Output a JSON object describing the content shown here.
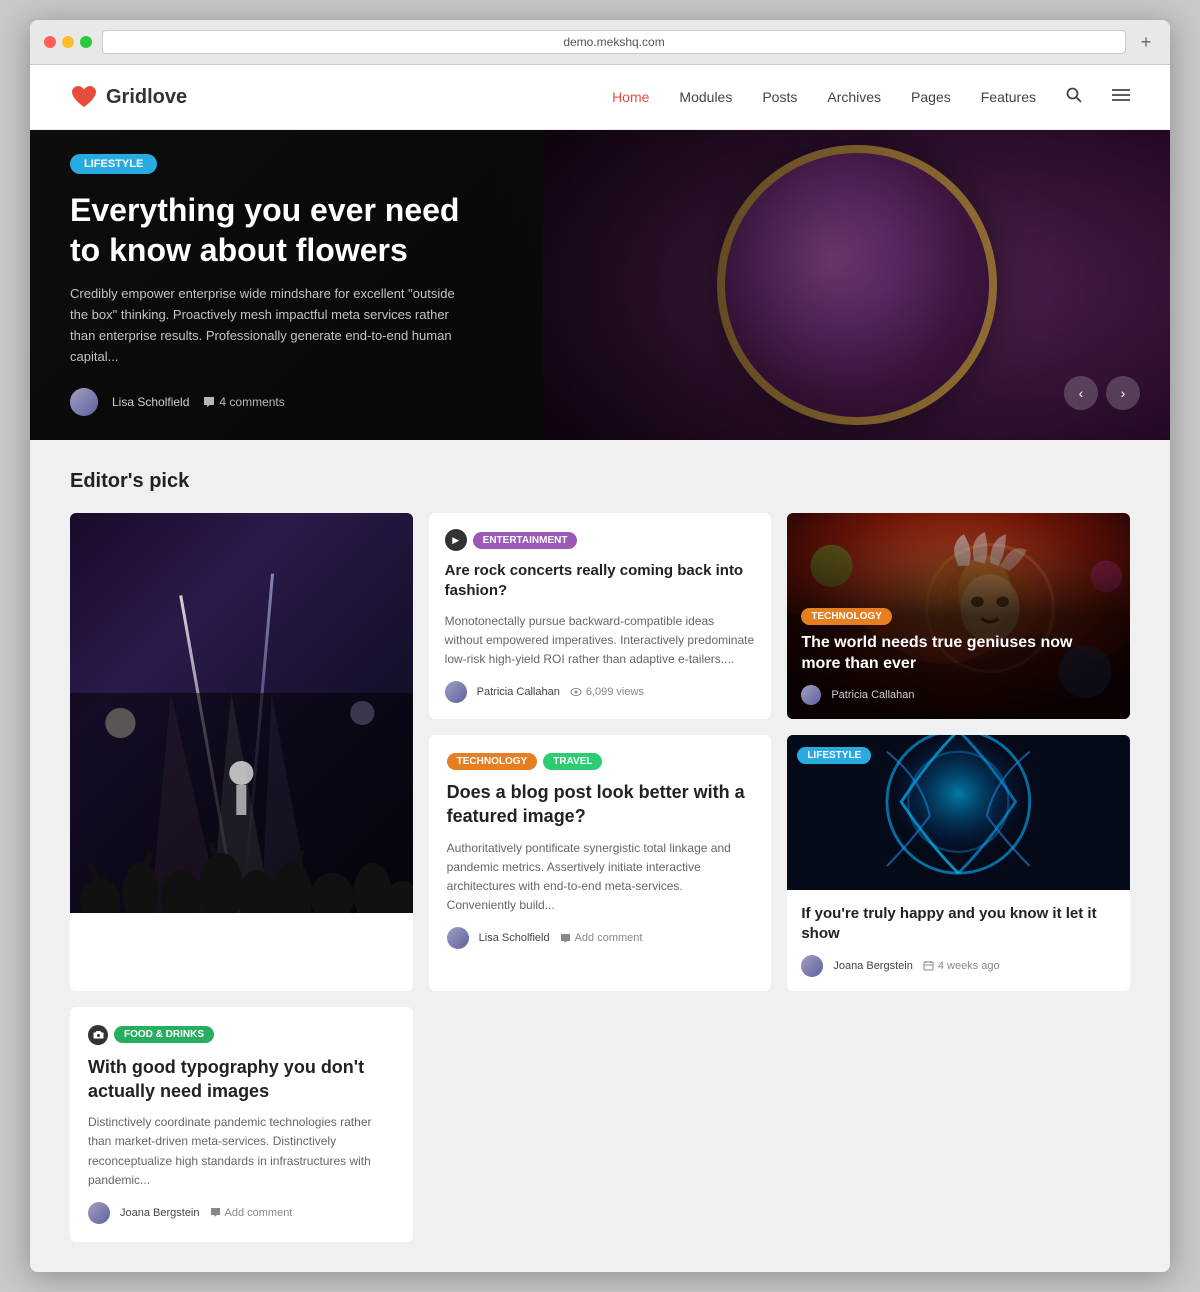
{
  "browser": {
    "address": "demo.mekshq.com",
    "refresh_icon": "↺"
  },
  "header": {
    "logo_text": "Gridlove",
    "nav": [
      {
        "label": "Home",
        "active": true
      },
      {
        "label": "Modules",
        "active": false
      },
      {
        "label": "Posts",
        "active": false
      },
      {
        "label": "Archives",
        "active": false
      },
      {
        "label": "Pages",
        "active": false
      },
      {
        "label": "Features",
        "active": false
      }
    ]
  },
  "hero": {
    "category": "LIFESTYLE",
    "title": "Everything you ever need to know about flowers",
    "description": "Credibly empower enterprise wide mindshare for excellent \"outside the box\" thinking. Proactively mesh impactful meta services rather than enterprise results. Professionally generate end-to-end human capital...",
    "author": "Lisa Scholfield",
    "comments": "4 comments",
    "prev_label": "‹",
    "next_label": "›"
  },
  "editors_pick": {
    "section_title": "Editor's pick",
    "cards": [
      {
        "id": "large-concert",
        "type": "large-image",
        "image_type": "concert"
      },
      {
        "id": "rock-concerts",
        "type": "text",
        "play_button": true,
        "category": "ENTERTAINMENT",
        "category_class": "cat-entertainment",
        "title": "Are rock concerts really coming back into fashion?",
        "description": "Monotonectally pursue backward-compatible ideas without empowered imperatives. Interactively predominate low-risk high-yield ROI rather than adaptive e-tailers....",
        "author": "Patricia Callahan",
        "views": "6,099 views",
        "show_views": true
      },
      {
        "id": "true-geniuses",
        "type": "image-overlay",
        "image_type": "tech",
        "category": "TECHNOLOGY",
        "category_class": "cat-technology",
        "title": "The world needs true geniuses now more than ever",
        "author": "Patricia Callahan"
      },
      {
        "id": "blog-post-image",
        "type": "no-image",
        "categories": [
          {
            "label": "TECHNOLOGY",
            "class": "cat-technology"
          },
          {
            "label": "TRAVEL",
            "class": "cat-travel"
          }
        ],
        "title": "Does a blog post look better with a featured image?",
        "description": "Authoritatively pontificate synergistic total linkage and pandemic metrics. Assertively initiate interactive architectures with end-to-end meta-services. Conveniently build...",
        "author": "Lisa Scholfield",
        "comment_text": "Add comment",
        "show_comment": true
      },
      {
        "id": "truly-happy",
        "type": "image-bottom",
        "image_type": "fireworks",
        "category": "LIFESTYLE",
        "category_class": "cat-lifestyle",
        "title": "If you're truly happy and you know it let it show",
        "author": "Joana Bergstein",
        "date": "4 weeks ago"
      },
      {
        "id": "good-typography",
        "type": "no-image",
        "categories": [
          {
            "label": "FOOD & DRINKS",
            "class": "cat-food"
          }
        ],
        "camera_icon": true,
        "title": "With good typography you don't actually need images",
        "description": "Distinctively coordinate pandemic technologies rather than market-driven meta-services. Distinctively reconceptualize high standards in infrastructures with pandemic...",
        "author": "Joana Bergstein",
        "comment_text": "Add comment",
        "show_comment": true
      }
    ]
  }
}
